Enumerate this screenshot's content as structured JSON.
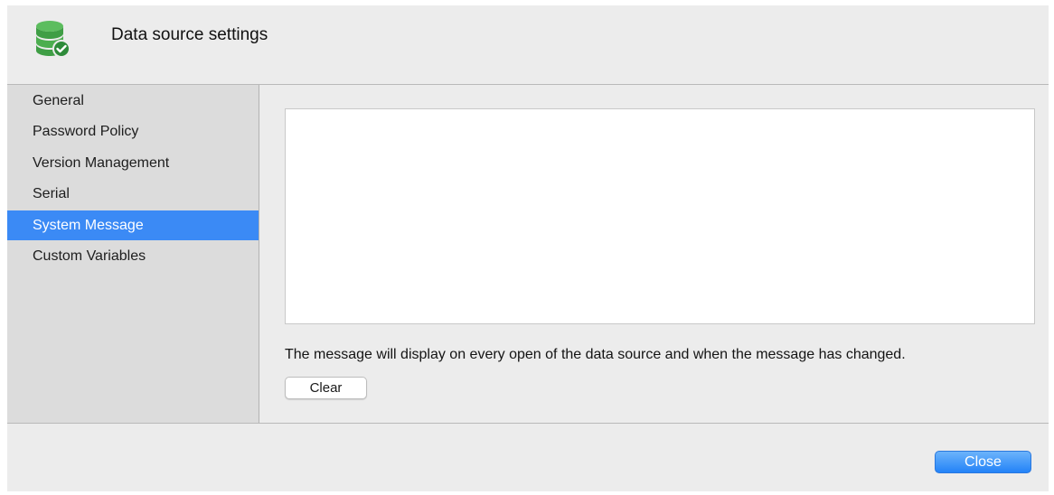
{
  "header": {
    "title": "Data source settings",
    "icon": "database-check-icon",
    "icon_colors": {
      "green": "#4cae4f",
      "dark_green": "#2e8b3a"
    }
  },
  "sidebar": {
    "items": [
      {
        "label": "General",
        "selected": false
      },
      {
        "label": "Password Policy",
        "selected": false
      },
      {
        "label": "Version Management",
        "selected": false
      },
      {
        "label": "Serial",
        "selected": false
      },
      {
        "label": "System Message",
        "selected": true
      },
      {
        "label": "Custom Variables",
        "selected": false
      }
    ],
    "selected_color": "#3b8af5"
  },
  "content": {
    "message_value": "",
    "info_text": "The message will display on every open of the data source and when the message has changed.",
    "clear_label": "Clear"
  },
  "footer": {
    "close_label": "Close",
    "close_color": "#2383f8"
  }
}
